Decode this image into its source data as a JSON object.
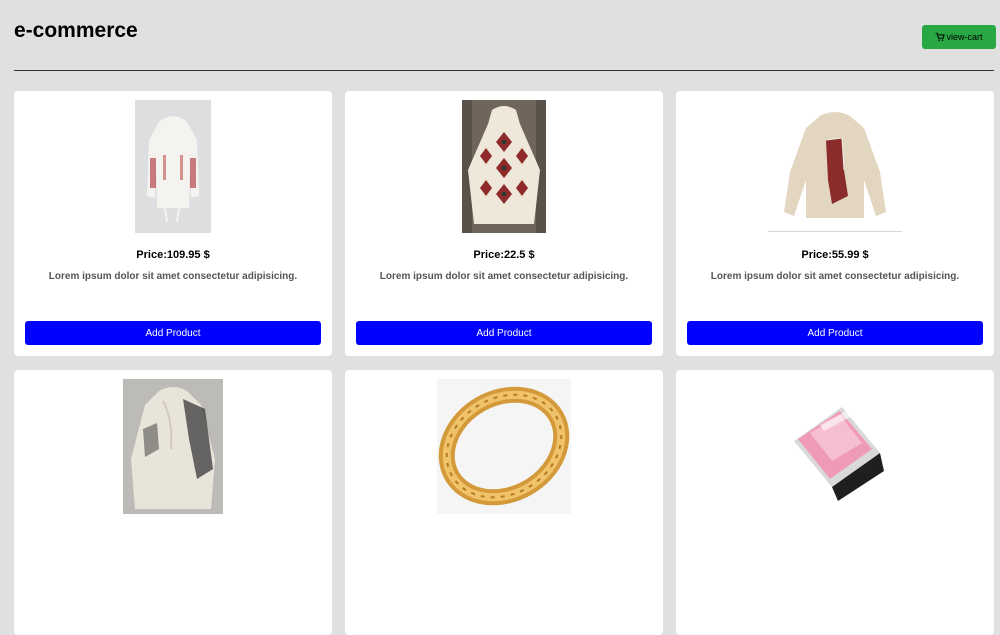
{
  "header": {
    "title": "e-commerce",
    "cart_label": "view-cart",
    "cart_icon": "shopping-cart-icon"
  },
  "colors": {
    "background": "#e0e0e0",
    "cart_button": "#28a745",
    "add_button": "#0000ff"
  },
  "products": [
    {
      "price": "Price:109.95 $",
      "description": "Lorem ipsum dolor sit amet consectetur adipisicing.",
      "button": "Add Product",
      "image": "white-hoodie-embroidered-sleeves"
    },
    {
      "price": "Price:22.5 $",
      "description": "Lorem ipsum dolor sit amet consectetur adipisicing.",
      "button": "Add Product",
      "image": "geometric-pattern-poncho"
    },
    {
      "price": "Price:55.99 $",
      "description": "Lorem ipsum dolor sit amet consectetur adipisicing.",
      "button": "Add Product",
      "image": "beige-hoodie-map-print"
    },
    {
      "image": "cream-hoodie-dragon-print"
    },
    {
      "image": "gold-bangle-bracelet"
    },
    {
      "image": "pink-blush-compact"
    }
  ]
}
